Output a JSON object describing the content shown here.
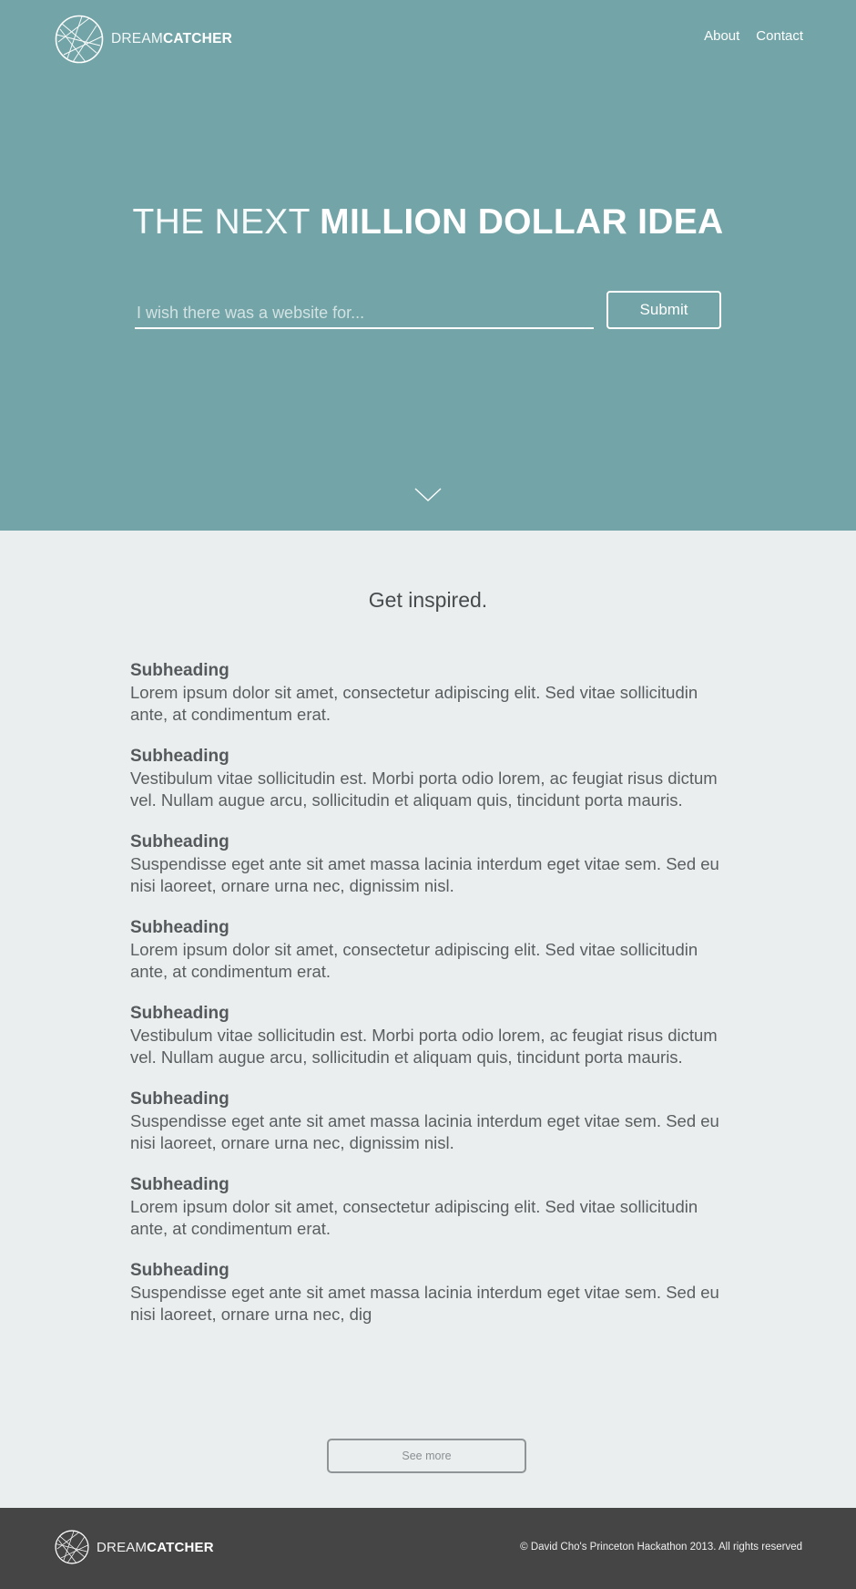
{
  "header": {
    "brand": {
      "light": "DREAM",
      "bold": "CATCHER"
    },
    "nav": [
      {
        "label": "About"
      },
      {
        "label": "Contact"
      }
    ]
  },
  "hero": {
    "headline_light": "THE NEXT ",
    "headline_bold": "MILLION DOLLAR IDEA",
    "input_placeholder": "I wish there was a website for...",
    "submit_label": "Submit",
    "scroll_icon": "chevron-down-icon"
  },
  "main": {
    "title": "Get inspired.",
    "articles": [
      {
        "heading": "Subheading",
        "body": "Lorem ipsum dolor sit amet, consectetur adipiscing elit. Sed vitae sollicitudin ante, at condimentum erat."
      },
      {
        "heading": "Subheading",
        "body": "Vestibulum vitae sollicitudin est. Morbi porta odio lorem, ac feugiat risus dictum vel. Nullam augue arcu, sollicitudin et aliquam quis, tincidunt porta mauris."
      },
      {
        "heading": "Subheading",
        "body": "Suspendisse eget ante sit amet massa lacinia interdum eget vitae sem. Sed eu nisi laoreet, ornare urna nec, dignissim nisl."
      },
      {
        "heading": "Subheading",
        "body": "Lorem ipsum dolor sit amet, consectetur adipiscing elit. Sed vitae sollicitudin ante, at condimentum erat."
      },
      {
        "heading": "Subheading",
        "body": "Vestibulum vitae sollicitudin est. Morbi porta odio lorem, ac feugiat risus dictum vel. Nullam augue arcu, sollicitudin et aliquam quis, tincidunt porta mauris."
      },
      {
        "heading": "Subheading",
        "body": "Suspendisse eget ante sit amet massa lacinia interdum eget vitae sem. Sed eu nisi laoreet, ornare urna nec, dignissim nisl."
      },
      {
        "heading": "Subheading",
        "body": "Lorem ipsum dolor sit amet, consectetur adipiscing elit. Sed vitae sollicitudin ante, at condimentum erat."
      },
      {
        "heading": "Subheading",
        "body": "Suspendisse eget ante sit amet massa lacinia interdum eget vitae sem. Sed eu nisi laoreet, ornare urna nec, dig"
      }
    ],
    "see_more_label": "See more"
  },
  "footer": {
    "brand": {
      "light": "DREAM",
      "bold": "CATCHER"
    },
    "copyright": "© David Cho's Princeton Hackathon 2013. All rights reserved"
  },
  "colors": {
    "hero_bg": "#73a4a7",
    "content_bg": "#ebeeef",
    "footer_bg": "#454545",
    "text": "#555a5c"
  }
}
